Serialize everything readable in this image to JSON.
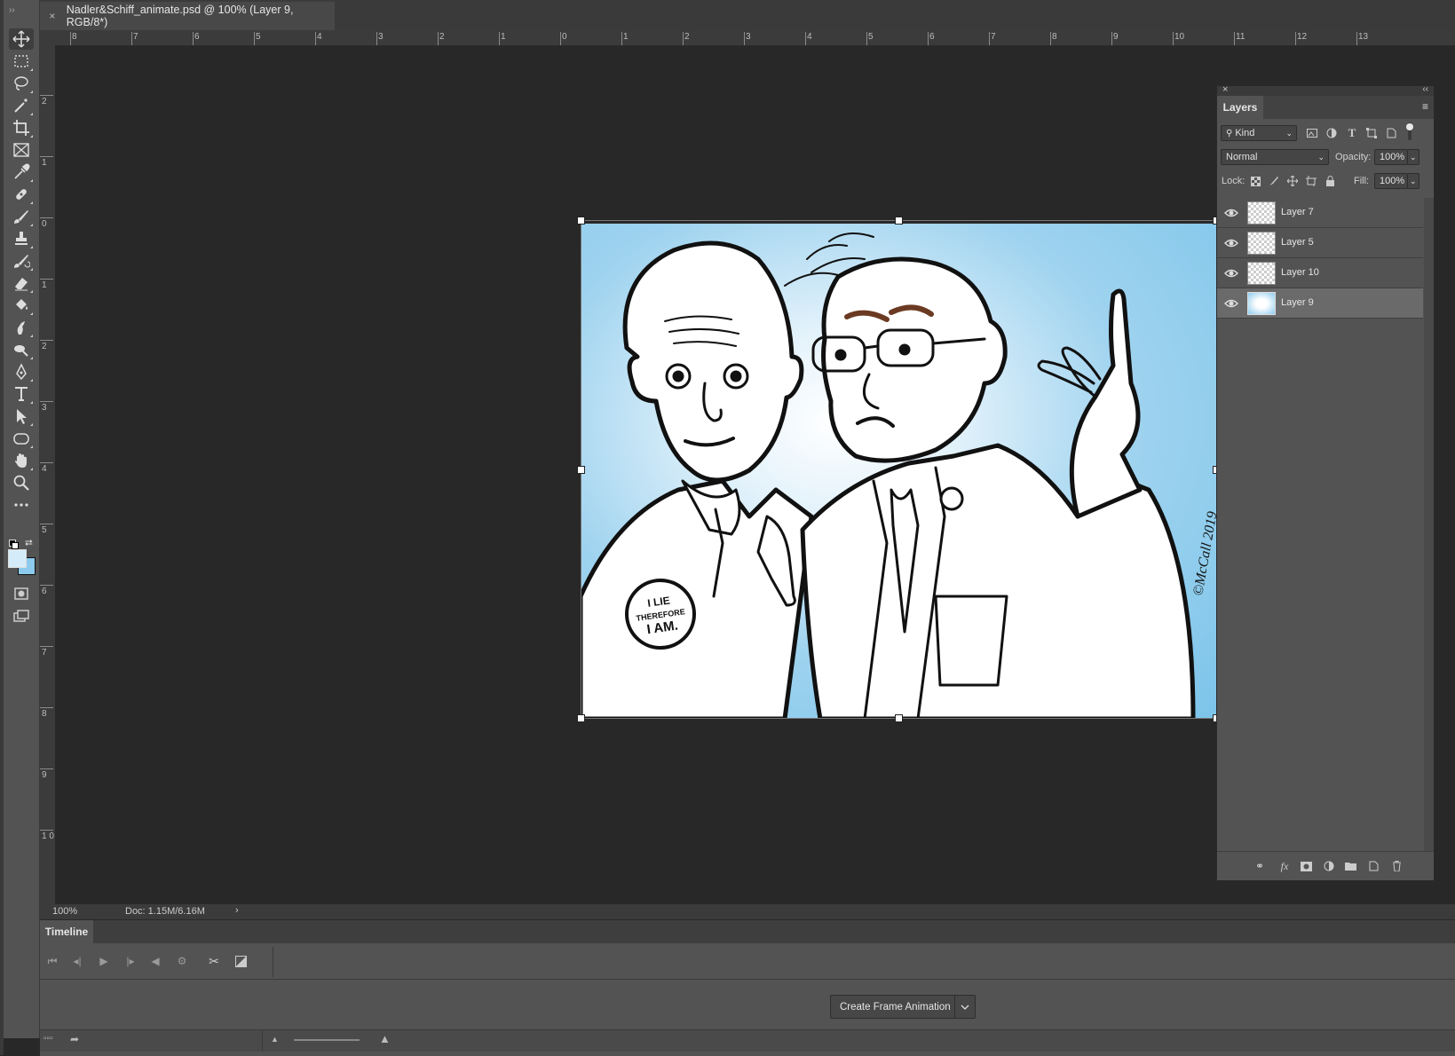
{
  "document": {
    "tab_title": "Nadler&Schiff_animate.psd @ 100% (Layer 9, RGB/8*)",
    "close_glyph": "×"
  },
  "rulers": {
    "top_labels": [
      "8",
      "7",
      "6",
      "5",
      "4",
      "3",
      "2",
      "1",
      "0",
      "1",
      "2",
      "3",
      "4",
      "5",
      "6",
      "7",
      "8",
      "9",
      "10",
      "11",
      "12",
      "13"
    ],
    "left_labels": [
      "2",
      "1",
      "0",
      "1",
      "2",
      "3",
      "4",
      "5",
      "6",
      "7",
      "8",
      "9",
      "1 0"
    ]
  },
  "toolbar": {
    "tools": [
      "move-tool",
      "marquee-tool",
      "lasso-tool",
      "magic-wand-tool",
      "crop-tool",
      "frame-tool",
      "eyedropper-tool",
      "healing-tool",
      "brush-tool",
      "stamp-tool",
      "history-brush-tool",
      "eraser-tool",
      "paint-bucket-tool",
      "smudge-tool",
      "dodge-tool",
      "pen-tool",
      "type-tool",
      "path-select-tool",
      "shape-tool",
      "hand-tool",
      "zoom-tool",
      "more-tools"
    ],
    "foreground_color": "#d4ecf9",
    "background_color": "#8ccbed"
  },
  "status": {
    "zoom": "100%",
    "doc_info": "Doc: 1.15M/6.16M",
    "arrow": "›"
  },
  "timeline": {
    "tab_label": "Timeline",
    "create_button_label": "Create Frame Animation"
  },
  "layers_panel": {
    "tab_label": "Layers",
    "filter_kind": "Kind",
    "blend_mode": "Normal",
    "opacity_label": "Opacity:",
    "opacity_value": "100%",
    "lock_label": "Lock:",
    "fill_label": "Fill:",
    "fill_value": "100%",
    "layers": [
      {
        "name": "Layer 7",
        "visible": true,
        "selected": false
      },
      {
        "name": "Layer 5",
        "visible": true,
        "selected": false
      },
      {
        "name": "Layer 10",
        "visible": true,
        "selected": false
      },
      {
        "name": "Layer 9",
        "visible": true,
        "selected": true
      }
    ]
  },
  "artwork": {
    "badge_line1": "I LIE",
    "badge_line2": "THEREFORE",
    "badge_line3": "I AM.",
    "signature": "©McCall 2019"
  }
}
